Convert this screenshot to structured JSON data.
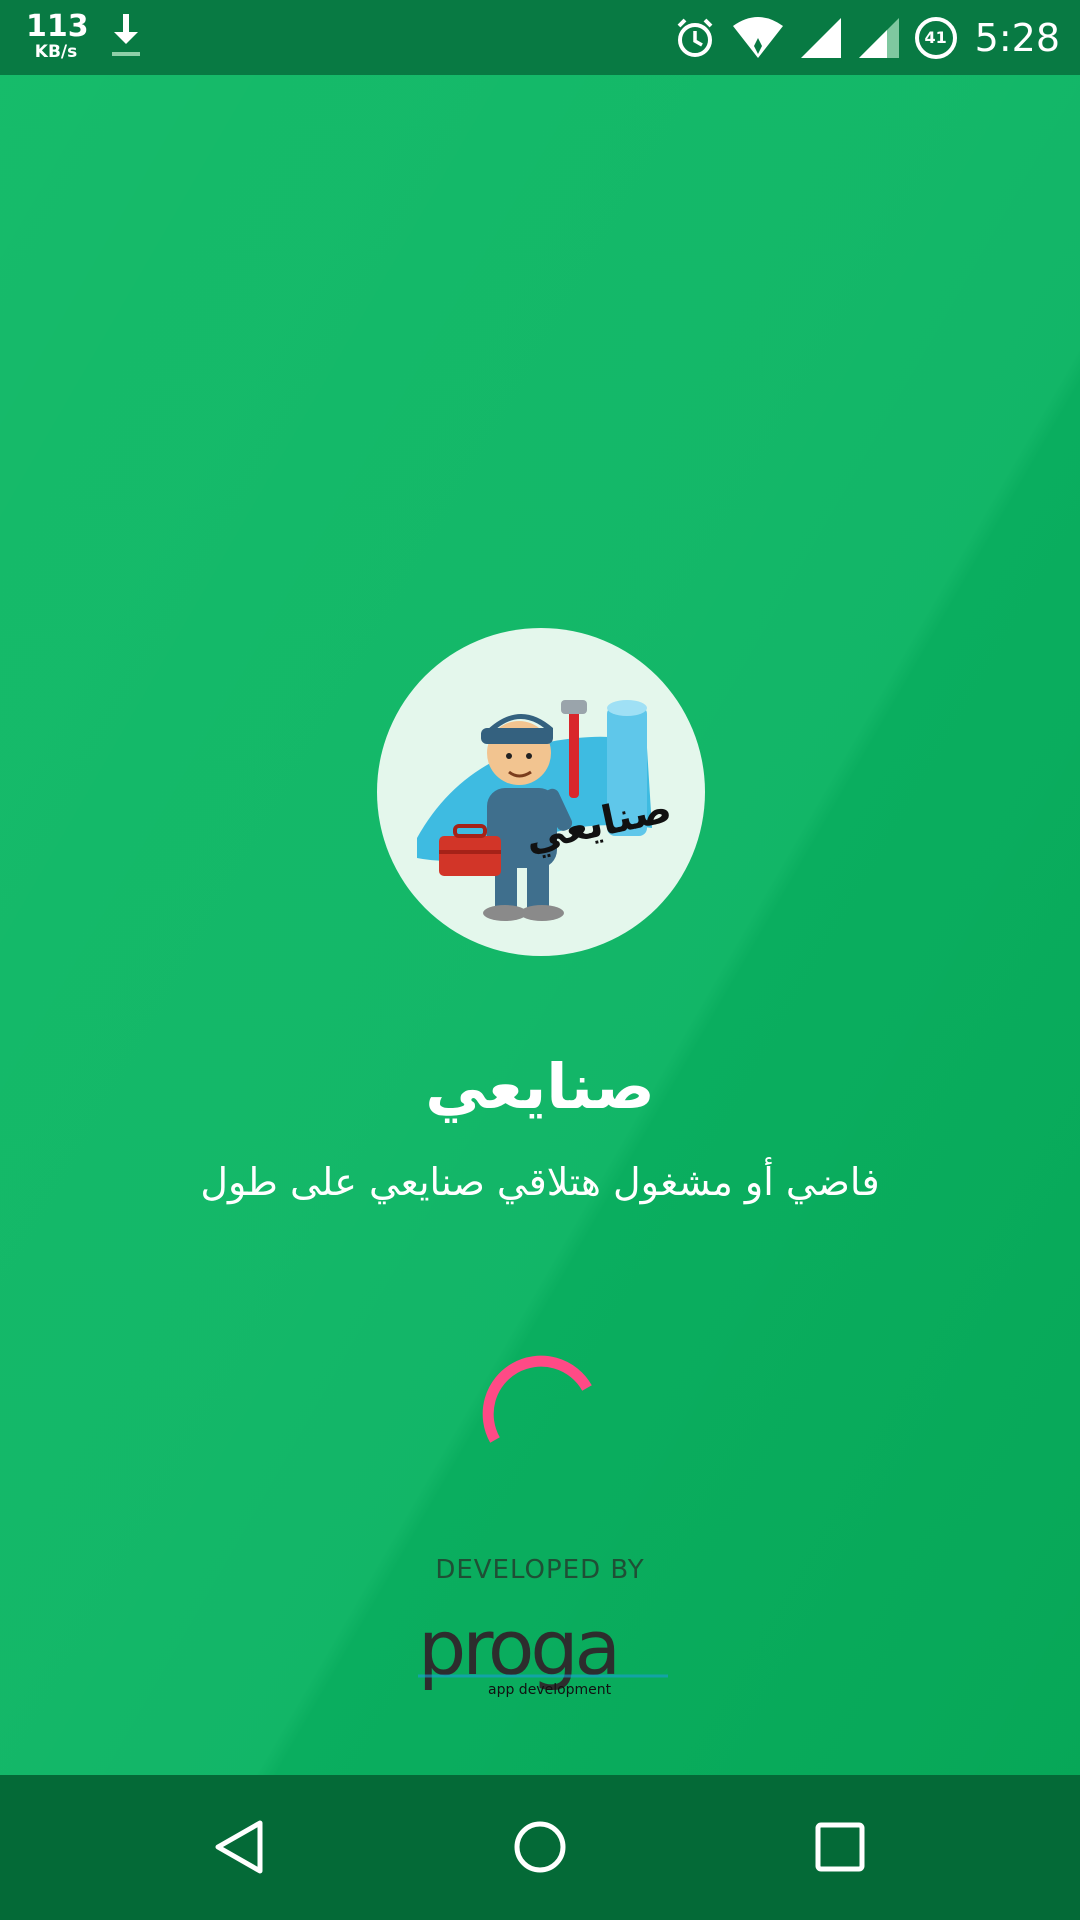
{
  "status_bar": {
    "speed_value": "113",
    "speed_unit": "KB/s",
    "battery_level": "41",
    "time": "5:28",
    "icons": [
      "download-icon",
      "alarm-icon",
      "wifi-icon",
      "signal-icon",
      "signal-icon-2",
      "battery-icon"
    ]
  },
  "splash": {
    "app_name": "صنايعي",
    "tagline": "فاضي أو مشغول هتلاقي صنايعي على طول",
    "logo_text": "صنايعي",
    "loading": true
  },
  "footer": {
    "developed_by": "DEVELOPED BY",
    "developer_logo": "proga",
    "developer_tag": "app development"
  },
  "nav_bar": {
    "buttons": [
      "back",
      "home",
      "recents"
    ]
  },
  "colors": {
    "background": "#0bb65f",
    "status_bar": "#087a43",
    "nav_bar": "#046a37",
    "spinner": "#ff4a86",
    "logo_circle": "#e4f7ec"
  }
}
